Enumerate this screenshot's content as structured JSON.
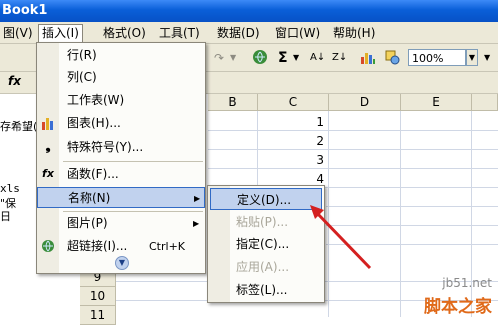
{
  "window": {
    "title": "Book1"
  },
  "menubar": {
    "items": [
      {
        "label": "图(V)"
      },
      {
        "label": "插入(I)"
      },
      {
        "label": "格式(O)"
      },
      {
        "label": "工具(T)"
      },
      {
        "label": "数据(D)"
      },
      {
        "label": "窗口(W)"
      },
      {
        "label": "帮助(H)"
      }
    ]
  },
  "toolbar": {
    "zoom": "100%",
    "sigma": "Σ"
  },
  "formula": {
    "fx": "fx"
  },
  "left_panel": {
    "line1": "存希望(",
    "line2": "xls",
    "line3": "\"保",
    "line4": "日"
  },
  "sheet": {
    "columns": [
      "B",
      "C",
      "D",
      "E"
    ],
    "rows": [
      "9",
      "10",
      "11"
    ],
    "c_values": [
      "1",
      "2",
      "3",
      "4"
    ]
  },
  "insert_menu": {
    "items": [
      {
        "label": "行(R)",
        "icon": "row-icon"
      },
      {
        "label": "列(C)",
        "icon": "column-icon"
      },
      {
        "label": "工作表(W)",
        "icon": ""
      },
      {
        "label": "图表(H)...",
        "icon": "chart-icon"
      },
      {
        "label": "特殊符号(Y)...",
        "icon": "symbol-icon"
      },
      {
        "label": "函数(F)...",
        "icon": "function-icon"
      },
      {
        "label": "名称(N)",
        "icon": ""
      },
      {
        "label": "图片(P)",
        "icon": ""
      },
      {
        "label": "超链接(I)...",
        "icon": "hyperlink-icon",
        "shortcut": "Ctrl+K"
      }
    ],
    "more": "expand-more-icon"
  },
  "name_submenu": {
    "items": [
      {
        "label": "定义(D)...",
        "enabled": true
      },
      {
        "label": "粘贴(P)...",
        "enabled": false
      },
      {
        "label": "指定(C)...",
        "enabled": true
      },
      {
        "label": "应用(A)...",
        "enabled": false
      },
      {
        "label": "标签(L)...",
        "enabled": true
      }
    ]
  },
  "watermark": {
    "line1": "jb51.net",
    "line2": "脚本之家"
  },
  "colors": {
    "highlight": "#c1d2ee",
    "highlight_border": "#316ac5",
    "arrow": "#d42020",
    "titlebar": "#0a5fd8"
  }
}
